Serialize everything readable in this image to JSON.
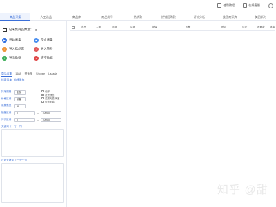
{
  "top": {
    "tabs": [
      {
        "label": "商品采集",
        "active": true
      },
      {
        "label": "人工选品",
        "active": false
      },
      {
        "label": "商品库",
        "active": false
      },
      {
        "label": "商品货号",
        "active": false
      },
      {
        "label": "热销款",
        "active": false
      },
      {
        "label": "热销回购款",
        "active": false
      },
      {
        "label": "评价分析",
        "active": false
      },
      {
        "label": "美团商家库",
        "active": false
      },
      {
        "label": "美团新时",
        "active": false
      }
    ],
    "links": {
      "help": "使用教程",
      "service": "在线客服"
    }
  },
  "left": {
    "count_label": "已采集商品数量：",
    "count_value": "0",
    "actions": [
      {
        "label": "开始采集",
        "color": "#2f6fe0",
        "glyph": "▶"
      },
      {
        "label": "停止采集",
        "color": "#4a8ff0",
        "glyph": "■"
      },
      {
        "label": "导入选品库",
        "color": "#f0963a",
        "glyph": "↓"
      },
      {
        "label": "导入货号",
        "color": "#e05a5a",
        "glyph": "↓"
      },
      {
        "label": "导出数据",
        "color": "#3fae5a",
        "glyph": "↑"
      },
      {
        "label": "清空数据",
        "color": "#e04848",
        "glyph": "×"
      }
    ],
    "subtabs": [
      "商品采集",
      "1688",
      "拼多多",
      "Shopee",
      "Lazada"
    ],
    "mode": [
      "搜索采集",
      "链接采集"
    ],
    "form": {
      "rows": [
        {
          "label": "排序规则：",
          "value": "全部",
          "kind": "select"
        },
        {
          "label": "价格区间：",
          "value": "销量",
          "kind": "select"
        },
        {
          "label": "采集数量：",
          "value": "40",
          "kind": "input"
        },
        {
          "label": "销量区间：",
          "from": "0",
          "to": "100000",
          "kind": "range"
        },
        {
          "label": "评价区间：",
          "from": "0",
          "to": "100000",
          "kind": "range"
        }
      ],
      "checkboxes": [
        "包邮",
        "过滤预售",
        "过滤天猫/淘宝",
        "包含天猫"
      ],
      "range_sep": "—"
    },
    "keywords_label": "关键词（一行一个）",
    "exclude_label": "过滤关键词（一行一个）"
  },
  "table": {
    "headers": [
      "序号",
      "主图",
      "标题",
      "店铺",
      "销量",
      "价格",
      "地址",
      "评论",
      "收藏数",
      "链接"
    ]
  },
  "watermark": "知乎 @甜"
}
